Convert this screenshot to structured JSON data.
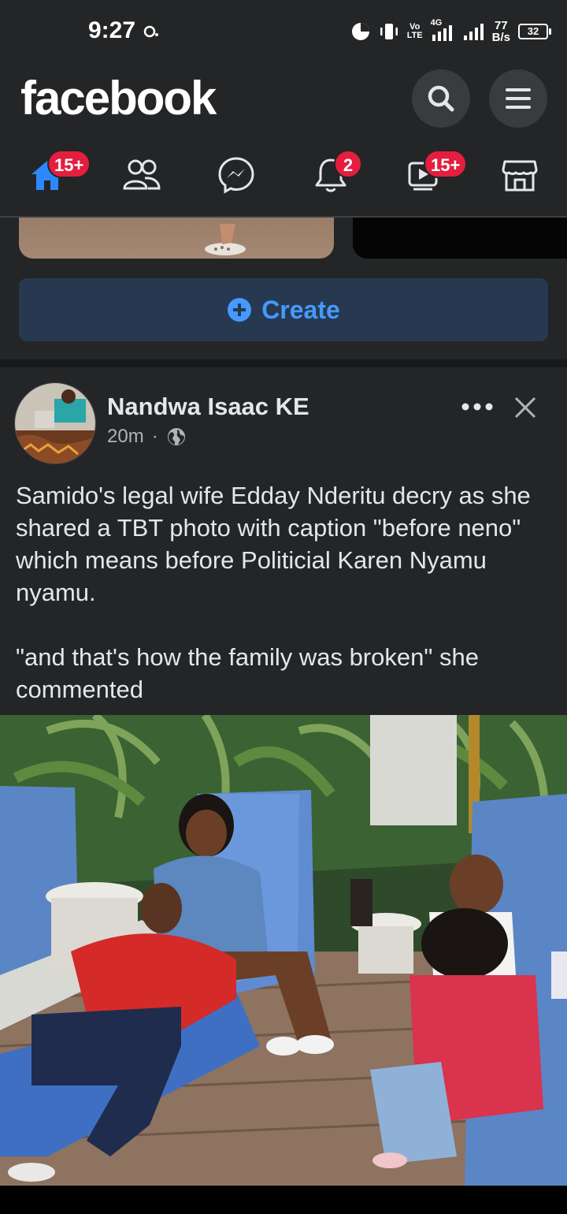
{
  "status_bar": {
    "time": "9:27",
    "net_speed_value": "77",
    "net_speed_unit": "B/s",
    "battery": "32",
    "network_label_top": "Vo",
    "network_label_bottom": "LTE",
    "network_gen": "4G"
  },
  "header": {
    "logo": "facebook",
    "search_icon": "search-icon",
    "menu_icon": "hamburger-menu-icon"
  },
  "tabs": [
    {
      "name": "home",
      "icon": "home-icon",
      "badge": "15+",
      "active": true
    },
    {
      "name": "friends",
      "icon": "friends-icon",
      "badge": ""
    },
    {
      "name": "messenger",
      "icon": "messenger-icon",
      "badge": ""
    },
    {
      "name": "notifications",
      "icon": "bell-icon",
      "badge": "2"
    },
    {
      "name": "watch",
      "icon": "video-icon",
      "badge": "15+"
    },
    {
      "name": "marketplace",
      "icon": "shop-icon",
      "badge": ""
    }
  ],
  "create": {
    "label": "Create"
  },
  "post": {
    "author": "Nandwa Isaac KE",
    "time": "20m",
    "separator": "·",
    "audience_icon": "globe-icon",
    "text": "Samido's legal wife Edday Nderitu decry as she shared a TBT photo with caption \"before neno\" which means before Politicial Karen Nyamu nyamu.\n\n\"and that's how the family was broken\" she commented"
  },
  "colors": {
    "background": "#242526",
    "accent": "#1877f2",
    "badge": "#e41e3f",
    "create_bg": "#263951",
    "create_text": "#4599ff"
  }
}
